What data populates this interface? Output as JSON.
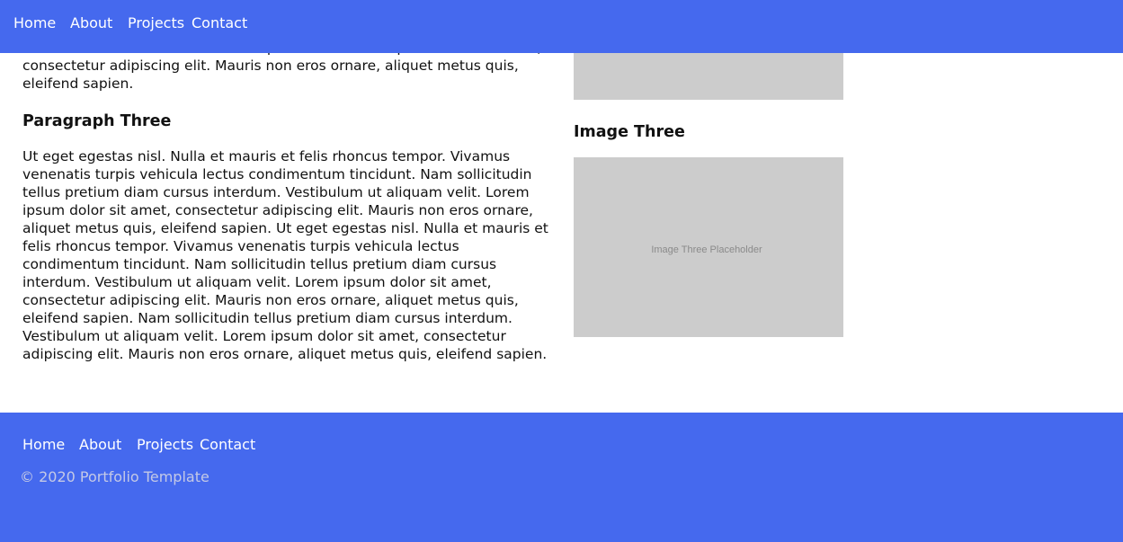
{
  "nav": {
    "items": [
      {
        "label": "Home"
      },
      {
        "label": "About"
      },
      {
        "label": "Projects"
      },
      {
        "label": "Contact"
      }
    ]
  },
  "content": {
    "paragraph_two_tail": "Ut eget egestas nisl. Nulla et mauris et felis rhoncus tempor. Vivamus venenatis turpis vehicula lectus condimentum tincidunt. Nam sollicitudin tellus pretium diam cursus interdum. Vestibulum ut aliquam velit. Lorem ipsum dolor sit amet, consectetur adipiscing elit. Mauris non eros ornare, aliquet metus quis, eleifend sapien. Nam sollicitudin tellus pretium diam cursus interdum. Vestibulum ut aliquam velit. Lorem ipsum dolor sit amet, consectetur adipiscing elit. Mauris non eros ornare, aliquet metus quis, eleifend sapien.",
    "paragraph_three": {
      "heading": "Paragraph Three",
      "text": "Ut eget egestas nisl. Nulla et mauris et felis rhoncus tempor. Vivamus venenatis turpis vehicula lectus condimentum tincidunt. Nam sollicitudin tellus pretium diam cursus interdum. Vestibulum ut aliquam velit. Lorem ipsum dolor sit amet, consectetur adipiscing elit. Mauris non eros ornare, aliquet metus quis, eleifend sapien. Ut eget egestas nisl. Nulla et mauris et felis rhoncus tempor. Vivamus venenatis turpis vehicula lectus condimentum tincidunt. Nam sollicitudin tellus pretium diam cursus interdum. Vestibulum ut aliquam velit. Lorem ipsum dolor sit amet, consectetur adipiscing elit. Mauris non eros ornare, aliquet metus quis, eleifend sapien. Nam sollicitudin tellus pretium diam cursus interdum. Vestibulum ut aliquam velit. Lorem ipsum dolor sit amet, consectetur adipiscing elit. Mauris non eros ornare, aliquet metus quis, eleifend sapien."
    },
    "image_three": {
      "heading": "Image Three",
      "caption": "Image Three Placeholder"
    }
  },
  "footer": {
    "nav": [
      {
        "label": "Home"
      },
      {
        "label": "About"
      },
      {
        "label": "Projects"
      },
      {
        "label": "Contact"
      }
    ],
    "copyright": "© 2020 Portfolio Template"
  },
  "colors": {
    "nav_background": "#4569ee",
    "nav_text": "#ffffff",
    "placeholder_background": "#cccccc",
    "copyright_text": "#c4c9e6"
  }
}
